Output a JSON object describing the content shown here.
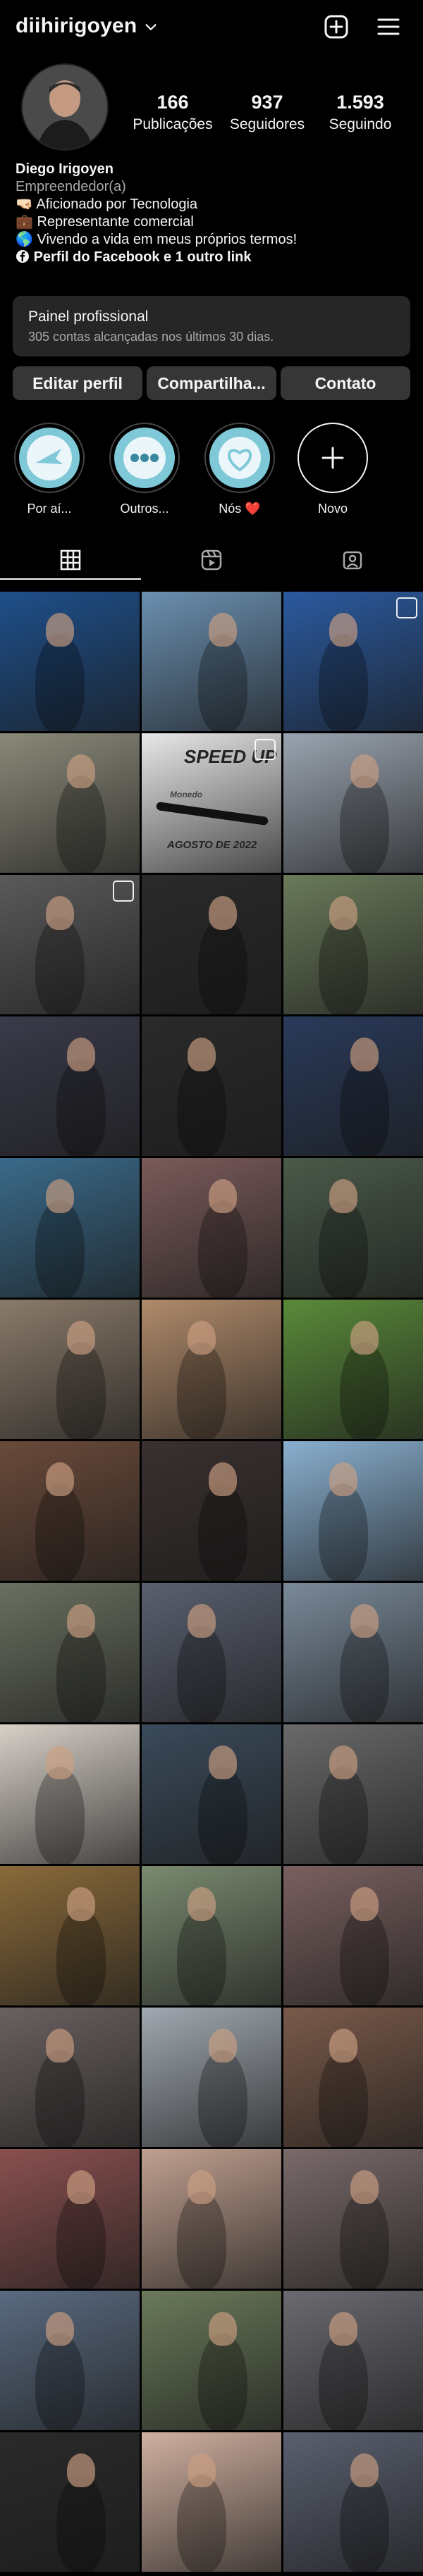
{
  "header": {
    "username": "diihirigoyen",
    "icons": [
      "chevron-down-icon",
      "plus-square-icon",
      "menu-icon"
    ]
  },
  "stats": [
    {
      "value": "166",
      "label": "Publicações"
    },
    {
      "value": "937",
      "label": "Seguidores"
    },
    {
      "value": "1.593",
      "label": "Seguindo"
    }
  ],
  "bio": {
    "name": "Diego Irigoyen",
    "category": "Empreendedor(a)",
    "lines": [
      "🤜🏻 Aficionado por Tecnologia",
      "💼 Representante comercial",
      "🌎 Vivendo a vida em meus próprios termos!"
    ],
    "link": "Perfil do Facebook e 1 outro link"
  },
  "dashboard": {
    "title": "Painel profissional",
    "subtitle": "305 contas alcançadas nos últimos 30 dias."
  },
  "buttons": {
    "edit": "Editar perfil",
    "share": "Compartilha...",
    "contact": "Contato"
  },
  "highlights": [
    {
      "label": "Por aí..."
    },
    {
      "label": "Outros..."
    },
    {
      "label": "Nós ❤️"
    },
    {
      "label": "Novo"
    }
  ],
  "tabs": [
    "grid-icon",
    "reels-icon",
    "tagged-icon"
  ],
  "grid": {
    "post_overlay_text_1": "SPEED UP",
    "post_overlay_text_2": "AGOSTO DE 2022",
    "post_overlay_text_3": "Monedo",
    "tile_colors": [
      "#1e4f8a",
      "#6a8fb0",
      "#2b5aa0",
      "#8a8a7a",
      "#e8e8e8",
      "#9aa4b0",
      "#5a5a5a",
      "#2a2a2a",
      "#6a7a5a",
      "#3a3a4a",
      "#2a2a2a",
      "#2a3a5a",
      "#3a6a8a",
      "#7a5a5a",
      "#4a5a4a",
      "#8a7a6a",
      "#b08a6a",
      "#5a8a3a",
      "#6a4a3a",
      "#3a3030",
      "#8ab0d0",
      "#6a7060",
      "#5a6070",
      "#7a8a9a",
      "#d8d0c8",
      "#3a4a5a",
      "#6a6a6a",
      "#8a6a3a",
      "#7a8a70",
      "#7a6060",
      "#6a6060",
      "#a0a8b0",
      "#7a5a4a",
      "#8a5050",
      "#c0a090",
      "#7a6a6a",
      "#5a6a80",
      "#6a7a5a",
      "#6a6a70",
      "#2a2a2a",
      "#d0b0a0",
      "#5a6070"
    ]
  }
}
